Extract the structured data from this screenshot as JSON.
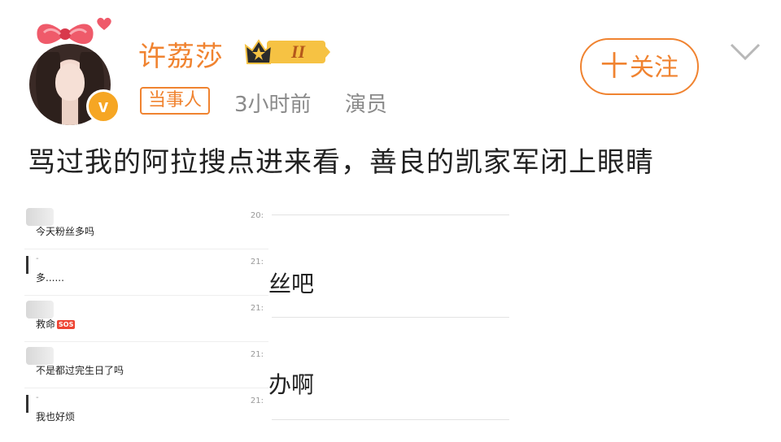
{
  "user": {
    "name": "许荔莎",
    "level": "II",
    "tag": "当事人",
    "time": "3小时前",
    "role": "演员"
  },
  "follow": {
    "label": "关注",
    "plus": "十"
  },
  "post": {
    "text": "骂过我的阿拉搜点进来看，善良的凯家军闭上眼睛"
  },
  "chat": [
    {
      "name": "",
      "msg": "今天粉丝多吗",
      "time": "20:"
    },
    {
      "name": "-",
      "msg": "多......",
      "time": "21:"
    },
    {
      "name": "",
      "msg": "救命",
      "time": "21:",
      "badge": "SOS"
    },
    {
      "name": "",
      "msg": "不是都过完生日了吗",
      "time": "21:"
    },
    {
      "name": "-",
      "msg": "我也好烦",
      "time": "21:"
    }
  ],
  "background_text": [
    "丝吧",
    "办啊"
  ],
  "icons": {
    "verified": "v-verified-badge",
    "bow": "bow-icon",
    "heart": "heart-icon",
    "crown": "crown-icon",
    "chevron": "chevron-down-icon"
  },
  "colors": {
    "accent": "#f08330",
    "secondary_text": "#8a8a8a"
  }
}
